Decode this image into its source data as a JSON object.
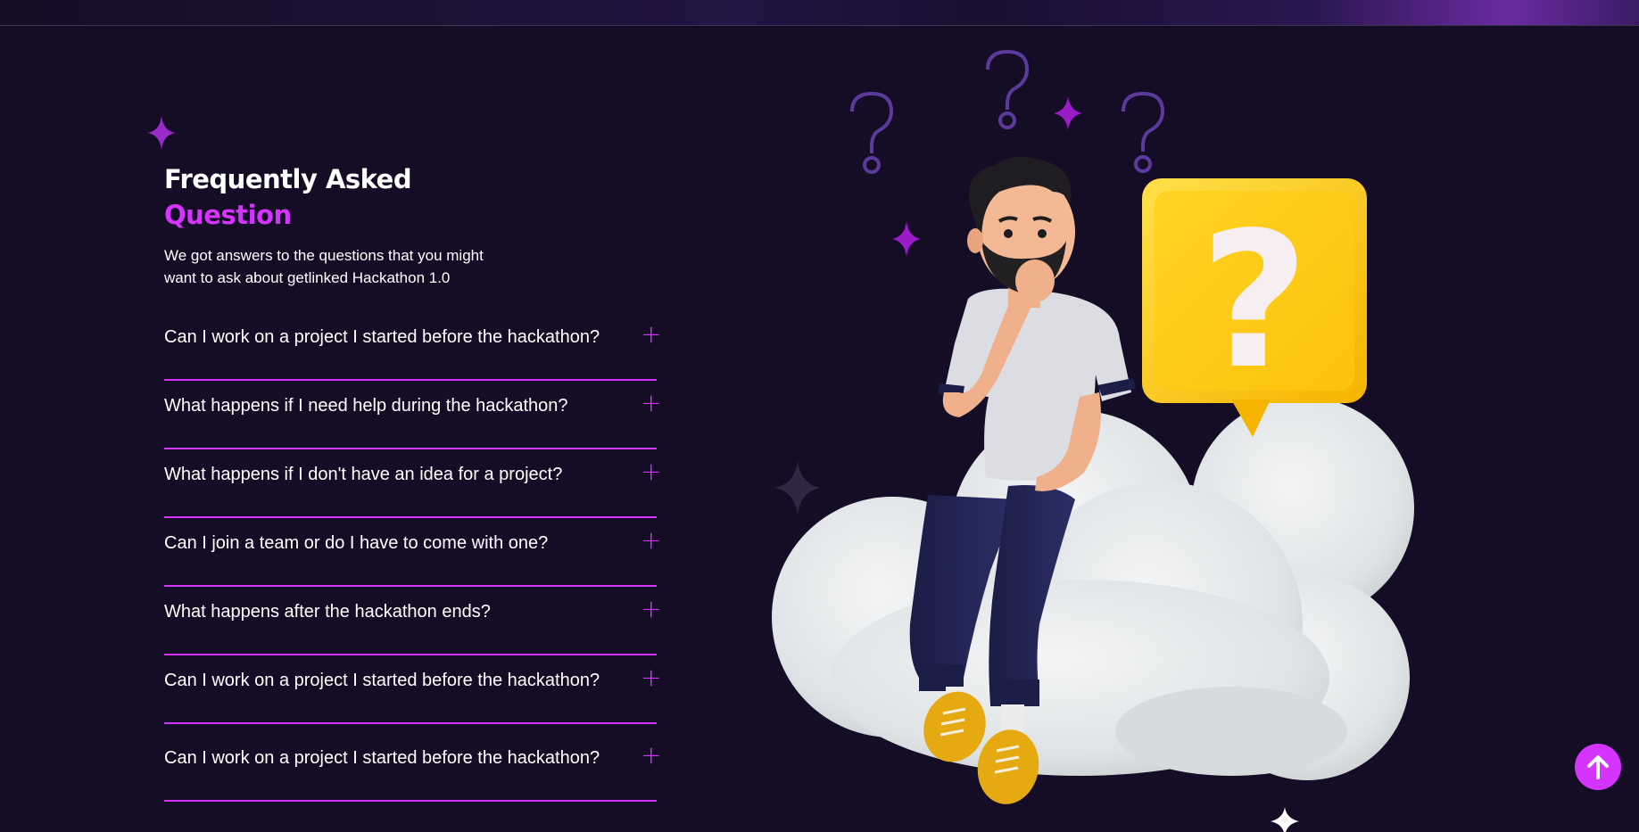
{
  "faq": {
    "title_line1": "Frequently Asked",
    "title_line2": "Question",
    "intro_line1": "We got answers to the questions that you might",
    "intro_line2": "want to ask about getlinked Hackathon 1.0",
    "items": [
      {
        "question": "Can I work on a project I started before the hackathon?",
        "icon": "plus-icon"
      },
      {
        "question": "What happens if I need help during the hackathon?",
        "icon": "plus-icon"
      },
      {
        "question": "What happens if I don't have an idea for a project?",
        "icon": "plus-icon"
      },
      {
        "question": "Can I join a team or do I have to come with one?",
        "icon": "plus-icon"
      },
      {
        "question": "What happens after the hackathon ends?",
        "icon": "plus-icon"
      },
      {
        "question": "Can I work on a project I started before the hackathon?",
        "icon": "plus-icon"
      },
      {
        "question": "Can I work on a project I started before the hackathon?",
        "icon": "plus-icon"
      }
    ]
  },
  "illustration": {
    "question_mark_glyph": "?",
    "description_icon": "thinking-man-on-cloud-illustration"
  },
  "scroll_top": {
    "icon": "arrow-up-icon"
  },
  "colors": {
    "background": "#150d26",
    "accent": "#d434fe",
    "text": "#ffffff",
    "bubble_yellow": "#ffc800"
  }
}
